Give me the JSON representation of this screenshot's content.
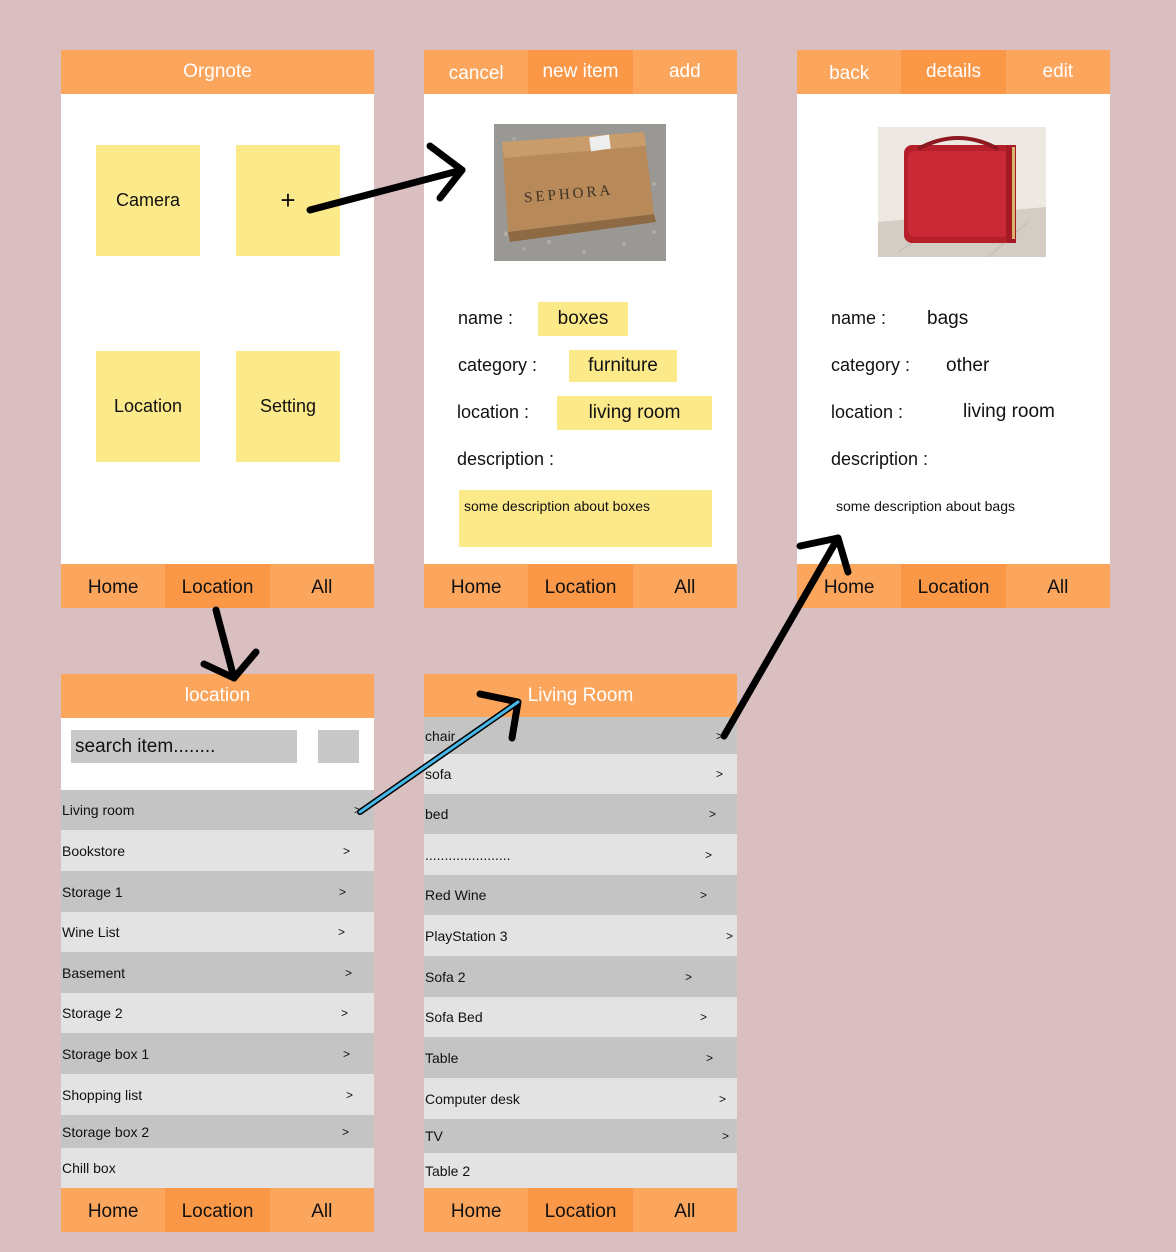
{
  "colors": {
    "background": "#d9bfc0",
    "bar": "#fca55c",
    "bar_active": "#fa9848",
    "tile": "#fce98a",
    "row_dark": "#c4c4c4",
    "row_light": "#e3e3e3"
  },
  "bottom_nav": {
    "home": "Home",
    "location": "Location",
    "all": "All"
  },
  "home": {
    "title": "Orgnote",
    "tiles": {
      "camera": "Camera",
      "add": "+",
      "location": "Location",
      "setting": "Setting"
    }
  },
  "new_item": {
    "cancel": "cancel",
    "title": "new item",
    "add": "add",
    "name_label": "name :",
    "name_value": "boxes",
    "category_label": "category :",
    "category_value": "furniture",
    "location_label": "location :",
    "location_value": "living room",
    "description_label": "description :",
    "description_value": "some description about boxes",
    "photo_text": "SEPHORA"
  },
  "details": {
    "back": "back",
    "title": "details",
    "edit": "edit",
    "name_label": "name :",
    "name_value": "bags",
    "category_label": "category :",
    "category_value": "other",
    "location_label": "location :",
    "location_value": "living room",
    "description_label": "description :",
    "description_value": "some description about bags"
  },
  "location_list": {
    "title": "location",
    "search_placeholder": "search item........",
    "rows": [
      {
        "label": "Living room",
        "chevron": ">"
      },
      {
        "label": "Bookstore",
        "chevron": ">"
      },
      {
        "label": "Storage 1",
        "chevron": ">"
      },
      {
        "label": "Wine List",
        "chevron": ">"
      },
      {
        "label": "Basement",
        "chevron": ">"
      },
      {
        "label": "Storage 2",
        "chevron": ">"
      },
      {
        "label": "Storage box 1",
        "chevron": ">"
      },
      {
        "label": "Shopping list",
        "chevron": ">"
      },
      {
        "label": "Storage box 2",
        "chevron": ">"
      },
      {
        "label": "Chill box",
        "chevron": ""
      }
    ]
  },
  "living_room": {
    "title": "Living Room",
    "rows": [
      {
        "label": "chair",
        "chevron": ">"
      },
      {
        "label": "sofa",
        "chevron": ">"
      },
      {
        "label": "bed",
        "chevron": ">"
      },
      {
        "label": "......................",
        "chevron": ">"
      },
      {
        "label": "Red Wine",
        "chevron": ">"
      },
      {
        "label": "PlayStation 3",
        "chevron": ">"
      },
      {
        "label": "Sofa 2",
        "chevron": ">"
      },
      {
        "label": "Sofa Bed",
        "chevron": ">"
      },
      {
        "label": "Table",
        "chevron": ">"
      },
      {
        "label": "Computer desk",
        "chevron": ">"
      },
      {
        "label": "TV",
        "chevron": ">"
      },
      {
        "label": "Table 2",
        "chevron": ""
      }
    ]
  }
}
